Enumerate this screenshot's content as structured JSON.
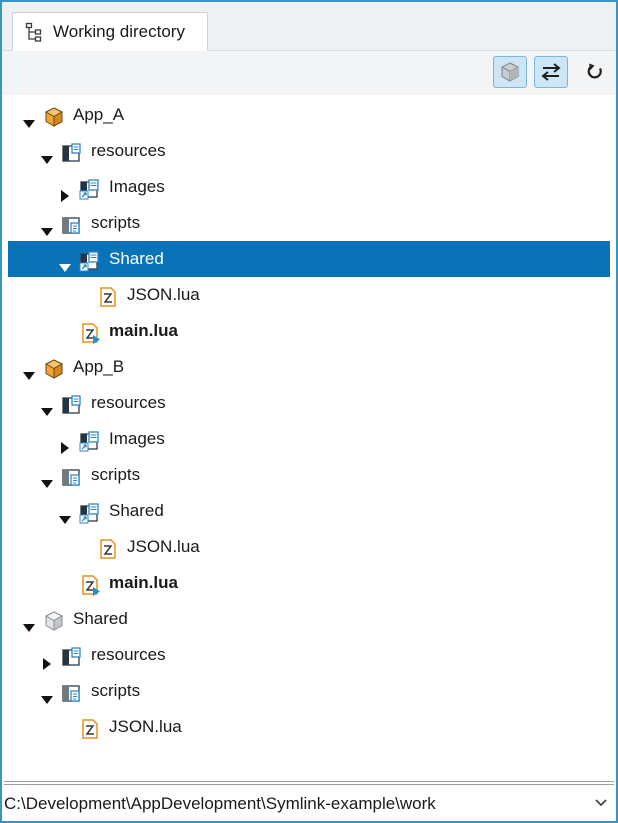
{
  "window": {
    "tab_label": "Working directory",
    "accent_color": "#0a73b8",
    "border_color": "#3a94c8"
  },
  "toolbar": {
    "buttons": [
      {
        "icon": "cube-icon",
        "state": "toggled"
      },
      {
        "icon": "link-arrows-icon",
        "state": "toggled"
      },
      {
        "icon": "refresh-icon",
        "state": "normal"
      }
    ]
  },
  "tree": {
    "rows": [
      {
        "label": "App_A",
        "depth": 0,
        "expander": "expanded",
        "icon": "project-icon",
        "bold": false,
        "selected": false
      },
      {
        "label": "resources",
        "depth": 1,
        "expander": "expanded",
        "icon": "resources-folder-icon",
        "bold": false,
        "selected": false
      },
      {
        "label": "Images",
        "depth": 2,
        "expander": "collapsed",
        "icon": "linked-folder-icon",
        "bold": false,
        "selected": false
      },
      {
        "label": "scripts",
        "depth": 1,
        "expander": "expanded",
        "icon": "scripts-folder-icon",
        "bold": false,
        "selected": false
      },
      {
        "label": "Shared",
        "depth": 2,
        "expander": "expanded",
        "icon": "linked-folder-icon",
        "bold": false,
        "selected": true
      },
      {
        "label": "JSON.lua",
        "depth": 3,
        "expander": "none",
        "icon": "lua-file-icon",
        "bold": false,
        "selected": false
      },
      {
        "label": "main.lua",
        "depth": 2,
        "expander": "none",
        "icon": "lua-main-file-icon",
        "bold": true,
        "selected": false
      },
      {
        "label": "App_B",
        "depth": 0,
        "expander": "expanded",
        "icon": "project-icon",
        "bold": false,
        "selected": false
      },
      {
        "label": "resources",
        "depth": 1,
        "expander": "expanded",
        "icon": "resources-folder-icon",
        "bold": false,
        "selected": false
      },
      {
        "label": "Images",
        "depth": 2,
        "expander": "collapsed",
        "icon": "linked-folder-icon",
        "bold": false,
        "selected": false
      },
      {
        "label": "scripts",
        "depth": 1,
        "expander": "expanded",
        "icon": "scripts-folder-icon",
        "bold": false,
        "selected": false
      },
      {
        "label": "Shared",
        "depth": 2,
        "expander": "expanded",
        "icon": "linked-folder-icon",
        "bold": false,
        "selected": false
      },
      {
        "label": "JSON.lua",
        "depth": 3,
        "expander": "none",
        "icon": "lua-file-icon",
        "bold": false,
        "selected": false
      },
      {
        "label": "main.lua",
        "depth": 2,
        "expander": "none",
        "icon": "lua-main-file-icon",
        "bold": true,
        "selected": false
      },
      {
        "label": "Shared",
        "depth": 0,
        "expander": "expanded",
        "icon": "library-project-icon",
        "bold": false,
        "selected": false
      },
      {
        "label": "resources",
        "depth": 1,
        "expander": "collapsed",
        "icon": "resources-folder-icon",
        "bold": false,
        "selected": false
      },
      {
        "label": "scripts",
        "depth": 1,
        "expander": "expanded",
        "icon": "scripts-folder-icon",
        "bold": false,
        "selected": false
      },
      {
        "label": "JSON.lua",
        "depth": 2,
        "expander": "none",
        "icon": "lua-file-icon",
        "bold": false,
        "selected": false
      }
    ]
  },
  "pathbar": {
    "path": "C:\\Development\\AppDevelopment\\Symlink-example\\work"
  }
}
